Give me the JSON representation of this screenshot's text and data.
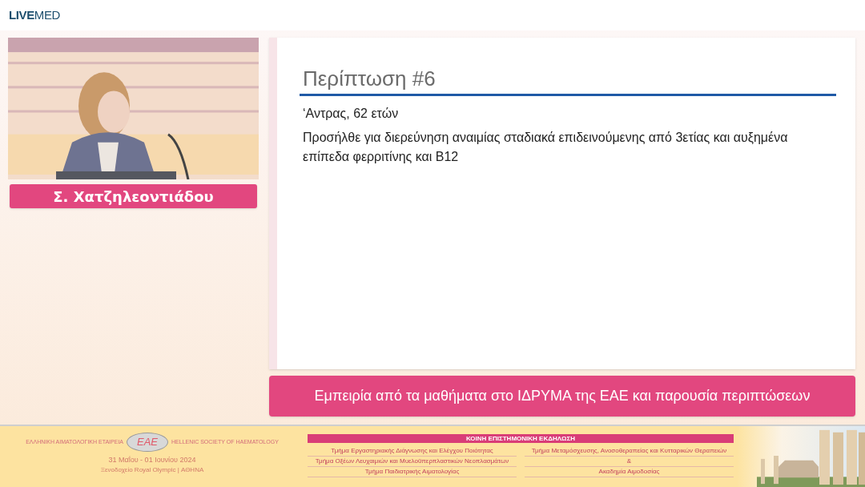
{
  "brand": {
    "bold": "LIVE",
    "light": "MED"
  },
  "speaker": {
    "name": "Σ. Χατζηλεοντιάδου"
  },
  "slide": {
    "title": "Περίπτωση #6",
    "paragraphs": [
      "‘Αντρας, 62 ετών",
      "Προσήλθε για διερεύνηση αναιμίας σταδιακά επιδεινούμενης από 3ετίας και αυξημένα επίπεδα φερριτίνης και Β12"
    ]
  },
  "session_title": "Εμπειρία από τα μαθήματα στο ΙΔΡΥΜΑ της ΕΑΕ και παρουσία περιπτώσεων",
  "footer": {
    "society_gr": "ΕΛΛΗΝΙΚΗ ΑΙΜΑΤΟΛΟΓΙΚΗ ΕΤΑΙΡΕΙΑ",
    "logo": "ΕΑΕ",
    "society_en": "HELLENIC SOCIETY OF HAEMATOLOGY",
    "dates": "31 Μαΐου - 01 Ιουνίου 2024",
    "venue": "Ξενοδοχείο Royal Olympic | ΑΘΗΝΑ",
    "banner": "ΚΟΙΝΗ ΕΠΙΣΤΗΜΟΝΙΚΗ ΕΚΔΗΛΩΣΗ",
    "left_column": [
      "Τμήμα Εργαστηριακής Διάγνωσης και Ελέγχου Ποιότητας",
      "Τμήμα Οξέων Λευχαιμιών και Μυελοϋπερπλαστικών Νεοπλασμάτων",
      "Τμήμα Παιδιατρικής Αιματολογίας"
    ],
    "right_column": [
      "Τμήμα Μεταμόσχευσης, Ανοσοθεραπείας και Κυτταρικών Θεραπειών",
      "&",
      "Ακαδημία Αιμοδοσίας"
    ]
  }
}
